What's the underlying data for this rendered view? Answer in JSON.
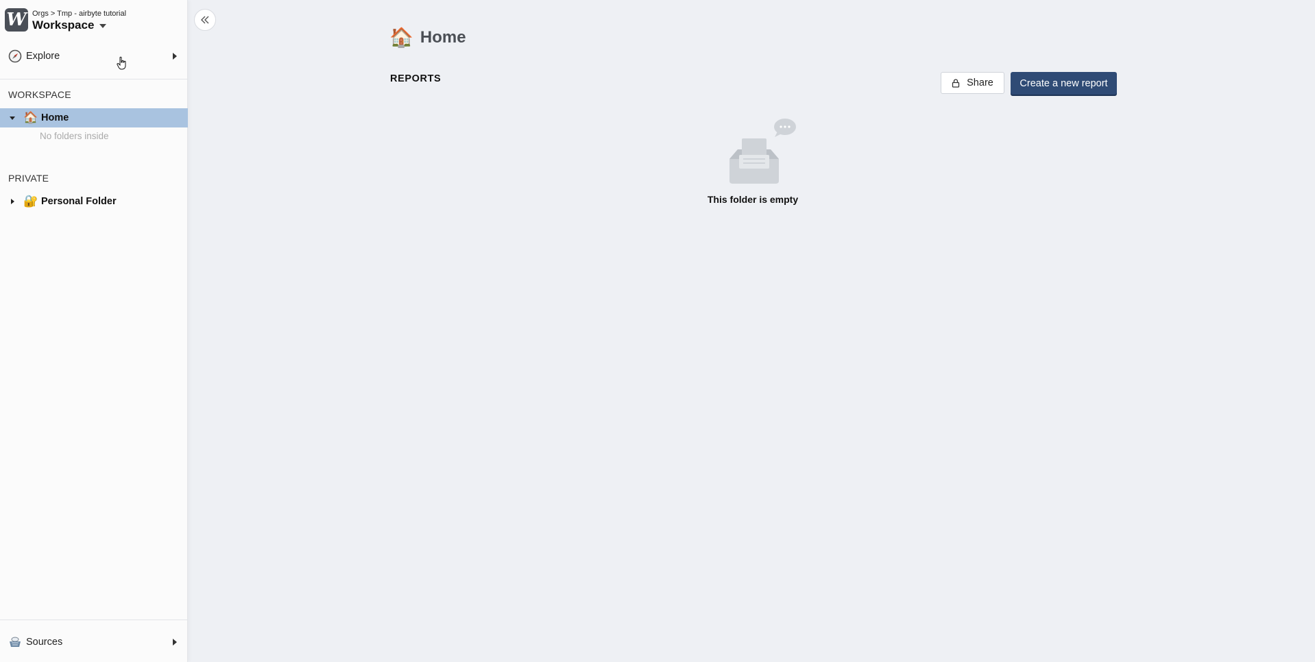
{
  "sidebar": {
    "breadcrumb": "Orgs > Tmp - airbyte tutorial",
    "workspace_title": "Workspace",
    "explore_label": "Explore",
    "workspace_section": "WORKSPACE",
    "home_label": "Home",
    "home_emoji": "🏠",
    "no_folders": "No folders inside",
    "private_section": "PRIVATE",
    "personal_label": "Personal Folder",
    "personal_emoji": "🔐",
    "sources_label": "Sources",
    "icons": {
      "logo": "W",
      "explore": "compass-icon",
      "sources": "basket-icon"
    }
  },
  "main": {
    "title": "Home",
    "title_emoji": "🏠",
    "reports_label": "REPORTS",
    "share_label": "Share",
    "create_label": "Create a new report",
    "empty_text": "This folder is empty"
  },
  "colors": {
    "primary_button": "#2f4b75",
    "active_row": "#a9c3e0",
    "background": "#eef0f4"
  }
}
